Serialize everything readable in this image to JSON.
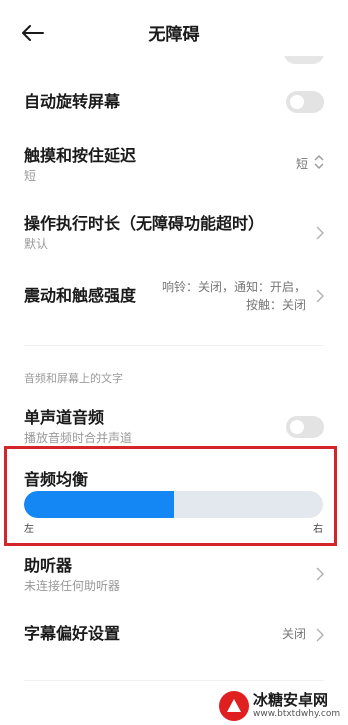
{
  "header": {
    "title": "无障碍"
  },
  "items": {
    "auto_rotate": {
      "title": "自动旋转屏幕"
    },
    "touch_delay": {
      "title": "触摸和按住延迟",
      "subtitle": "短",
      "value": "短"
    },
    "action_time": {
      "title": "操作执行时长（无障碍功能超时）",
      "subtitle": "默认"
    },
    "vibration": {
      "title": "震动和触感强度",
      "value_line1": "响铃：关闭，通知：开启，",
      "value_line2": "按触：关闭"
    },
    "mono_audio": {
      "title": "单声道音频",
      "subtitle": "播放音频时合并声道"
    },
    "audio_balance": {
      "title": "音频均衡",
      "left_label": "左",
      "right_label": "右",
      "position": 0.5
    },
    "hearing_aid": {
      "title": "助听器",
      "subtitle": "未连接任何助听器"
    },
    "caption_prefs": {
      "title": "字幕偏好设置",
      "value": "关闭"
    }
  },
  "sections": {
    "audio_text": "音频和屏幕上的文字"
  },
  "watermark": {
    "name": "冰糖安卓网",
    "url": "www.btxtdwhy.com"
  },
  "colors": {
    "accent": "#1487f5",
    "highlight": "#d4262a"
  }
}
